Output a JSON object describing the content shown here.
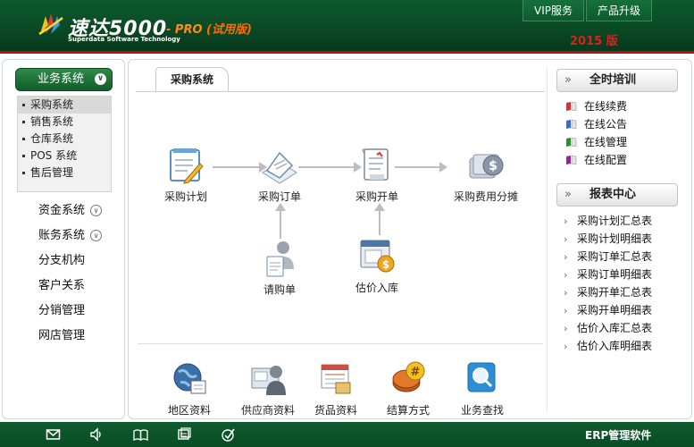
{
  "header": {
    "brand": "速达5000",
    "brand_sub": "Superdata Software Technology",
    "edition": "- PRO",
    "trial": "(试用版)",
    "year": "2015 版",
    "nav": [
      "VIP服务",
      "产品升级"
    ]
  },
  "sidebar": {
    "group": "业务系统",
    "submenu": [
      "采购系统",
      "销售系统",
      "仓库系统",
      "POS 系统",
      "售后管理"
    ],
    "items": [
      "资金系统",
      "账务系统",
      "分支机构",
      "客户关系",
      "分销管理",
      "网店管理"
    ]
  },
  "main": {
    "tab": "采购系统",
    "flow": [
      "采购计划",
      "采购订单",
      "采购开单",
      "采购费用分摊",
      "请购单",
      "估价入库"
    ],
    "bottom": [
      "地区资料",
      "供应商资料",
      "货品资料",
      "结算方式",
      "业务查找"
    ]
  },
  "right": {
    "training_title": "全时培训",
    "training_links": [
      "在线续费",
      "在线公告",
      "在线管理",
      "在线配置"
    ],
    "report_title": "报表中心",
    "reports": [
      "采购计划汇总表",
      "采购计划明细表",
      "采购订单汇总表",
      "采购订单明细表",
      "采购开单汇总表",
      "采购开单明细表",
      "估价入库汇总表",
      "估价入库明细表"
    ]
  },
  "footer": {
    "text": "ERP管理软件",
    "icons": [
      "mail-icon",
      "speaker-icon",
      "book-icon",
      "window-icon",
      "check-icon"
    ]
  }
}
